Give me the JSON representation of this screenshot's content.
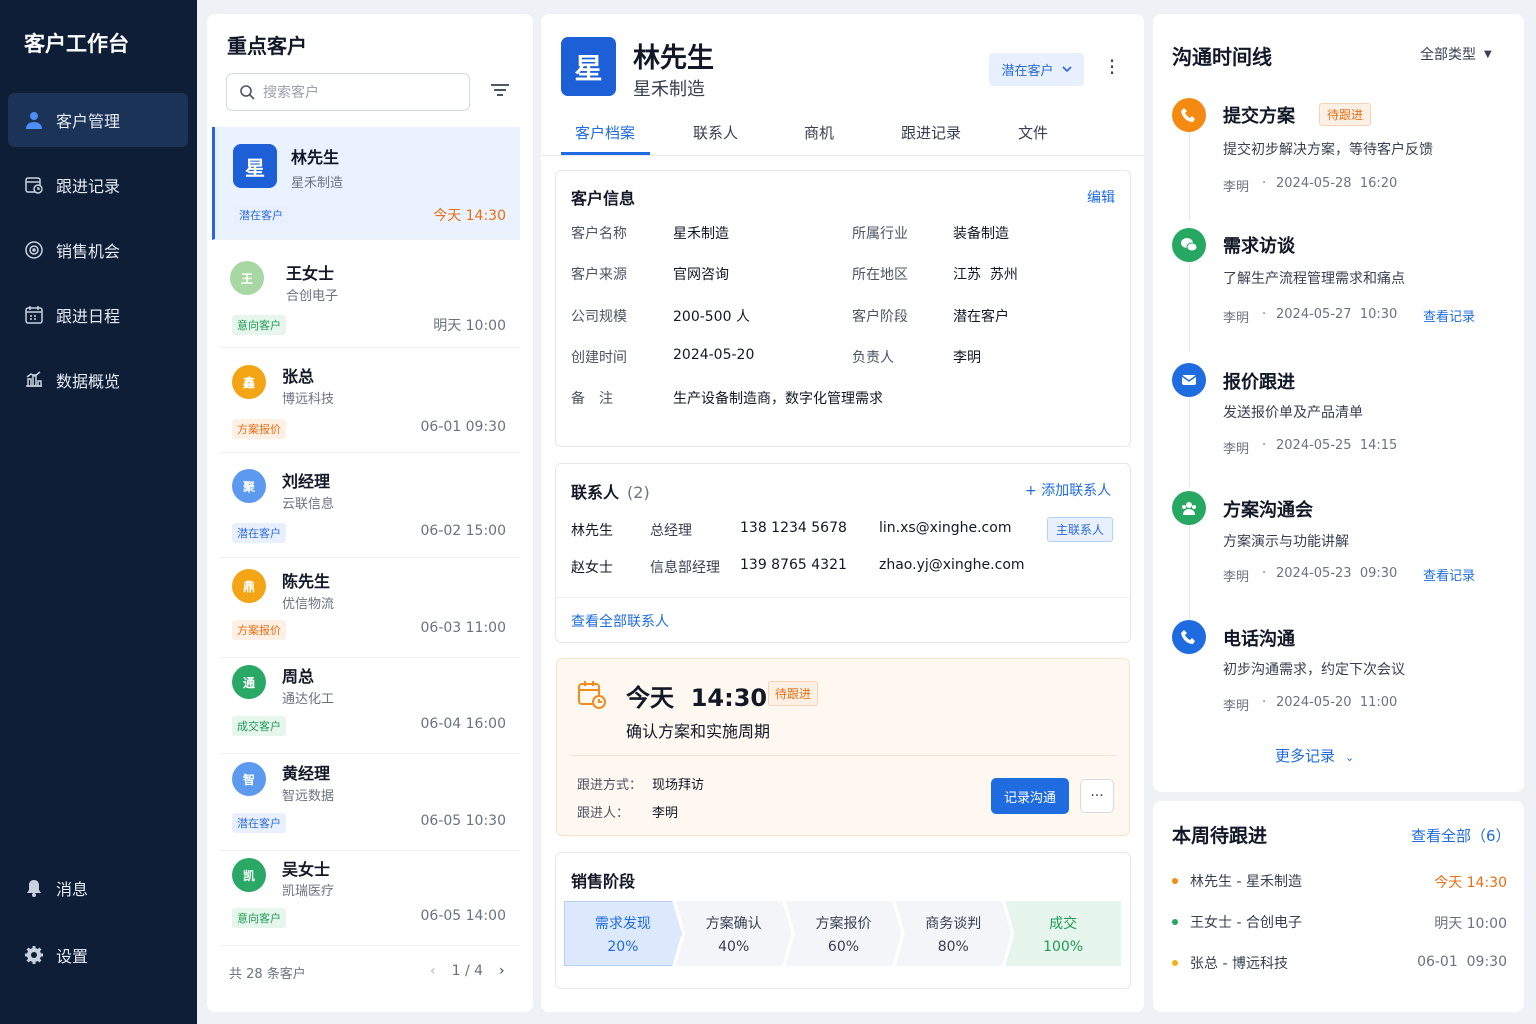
{
  "sidebar": {
    "title": "客户工作台",
    "items": [
      {
        "label": "客户管理"
      },
      {
        "label": "跟进记录"
      },
      {
        "label": "销售机会"
      },
      {
        "label": "跟进日程"
      },
      {
        "label": "数据概览"
      }
    ],
    "bottom": [
      {
        "label": "消息"
      },
      {
        "label": "设置"
      }
    ]
  },
  "list": {
    "title": "重点客户",
    "search_placeholder": "搜索客户",
    "customers": [
      {
        "avatar": "星",
        "name": "林先生",
        "company": "星禾制造",
        "tag": "潜在客户",
        "time": "今天 14:30"
      },
      {
        "avatar": "王",
        "name": "王女士",
        "company": "合创电子",
        "tag": "意向客户",
        "time": "明天 10:00"
      },
      {
        "avatar": "鑫",
        "name": "张总",
        "company": "博远科技",
        "tag": "方案报价",
        "time": "06-01 09:30"
      },
      {
        "avatar": "聚",
        "name": "刘经理",
        "company": "云联信息",
        "tag": "潜在客户",
        "time": "06-02 15:00"
      },
      {
        "avatar": "鼎",
        "name": "陈先生",
        "company": "优信物流",
        "tag": "方案报价",
        "time": "06-03 11:00"
      },
      {
        "avatar": "通",
        "name": "周总",
        "company": "通达化工",
        "tag": "成交客户",
        "time": "06-04 16:00"
      },
      {
        "avatar": "智",
        "name": "黄经理",
        "company": "智远数据",
        "tag": "潜在客户",
        "time": "06-05 10:30"
      },
      {
        "avatar": "凯",
        "name": "吴女士",
        "company": "凯瑞医疗",
        "tag": "意向客户",
        "time": "06-05 14:00"
      }
    ],
    "total": "共 28 条客户",
    "page": "1 / 4"
  },
  "detail": {
    "avatar": "星",
    "name": "林先生",
    "company": "星禾制造",
    "stage": "潜在客户",
    "tabs": [
      "客户档案",
      "联系人",
      "商机",
      "跟进记录",
      "文件"
    ],
    "info": {
      "title": "客户信息",
      "edit": "编辑",
      "rows": [
        {
          "l1": "客户名称",
          "v1": "星禾制造",
          "l2": "所属行业",
          "v2": "装备制造"
        },
        {
          "l1": "客户来源",
          "v1": "官网咨询",
          "l2": "所在地区",
          "v2": "江苏  苏州"
        },
        {
          "l1": "公司规模",
          "v1": "200-500 人",
          "l2": "客户阶段",
          "v2": "潜在客户"
        },
        {
          "l1": "创建时间",
          "v1": "2024-05-20",
          "l2": "负责人",
          "v2": "李明"
        }
      ],
      "note_label": "备　注",
      "note": "生产设备制造商，数字化管理需求"
    },
    "contacts": {
      "title": "联系人",
      "count": "(2)",
      "add": "添加联系人",
      "rows": [
        {
          "name": "林先生",
          "role": "总经理",
          "phone": "138 1234 5678",
          "email": "lin.xs@xinghe.com",
          "badge": "主联系人"
        },
        {
          "name": "赵女士",
          "role": "信息部经理",
          "phone": "139 8765 4321",
          "email": "zhao.yj@xinghe.com",
          "badge": ""
        }
      ],
      "view_all": "查看全部联系人"
    },
    "schedule": {
      "time": "今天  14:30",
      "tag": "待跟进",
      "subject": "确认方案和实施周期",
      "method_label": "跟进方式：",
      "method": "现场拜访",
      "owner_label": "跟进人：",
      "owner": "李明",
      "record_btn": "记录沟通",
      "more": "···"
    },
    "stages": {
      "title": "销售阶段",
      "items": [
        {
          "name": "需求发现",
          "pct": "20%"
        },
        {
          "name": "方案确认",
          "pct": "40%"
        },
        {
          "name": "方案报价",
          "pct": "60%"
        },
        {
          "name": "商务谈判",
          "pct": "80%"
        },
        {
          "name": "成交",
          "pct": "100%"
        }
      ]
    }
  },
  "timeline": {
    "title": "沟通时间线",
    "filter": "全部类型",
    "items": [
      {
        "icon": "phone-icon",
        "title": "提交方案",
        "tag": "待跟进",
        "desc": "提交初步解决方案，等待客户反馈",
        "user": "李明",
        "time": "2024-05-28  16:20",
        "link": ""
      },
      {
        "icon": "wechat-icon",
        "title": "需求访谈",
        "tag": "",
        "desc": "了解生产流程管理需求和痛点",
        "user": "李明",
        "time": "2024-05-27  10:30",
        "link": "查看记录"
      },
      {
        "icon": "mail-icon",
        "title": "报价跟进",
        "tag": "",
        "desc": "发送报价单及产品清单",
        "user": "李明",
        "time": "2024-05-25  14:15",
        "link": ""
      },
      {
        "icon": "meeting-icon",
        "title": "方案沟通会",
        "tag": "",
        "desc": "方案演示与功能讲解",
        "user": "李明",
        "time": "2024-05-23  09:30",
        "link": "查看记录"
      },
      {
        "icon": "phone-icon",
        "title": "电话沟通",
        "tag": "",
        "desc": "初步沟通需求，约定下次会议",
        "user": "李明",
        "time": "2024-05-20  11:00",
        "link": ""
      }
    ],
    "more": "更多记录"
  },
  "week": {
    "title": "本周待跟进",
    "view_all": "查看全部（6）",
    "items": [
      {
        "text": "林先生 - 星禾制造",
        "time": "今天 14:30"
      },
      {
        "text": "王女士 - 合创电子",
        "time": "明天 10:00"
      },
      {
        "text": "张总 - 博远科技",
        "time": "06-01  09:30"
      }
    ]
  },
  "colors": {
    "accent": "#1f6ce0",
    "sidebar": "#0d1e36",
    "orange": "#f08c1f",
    "green": "#27a862"
  }
}
